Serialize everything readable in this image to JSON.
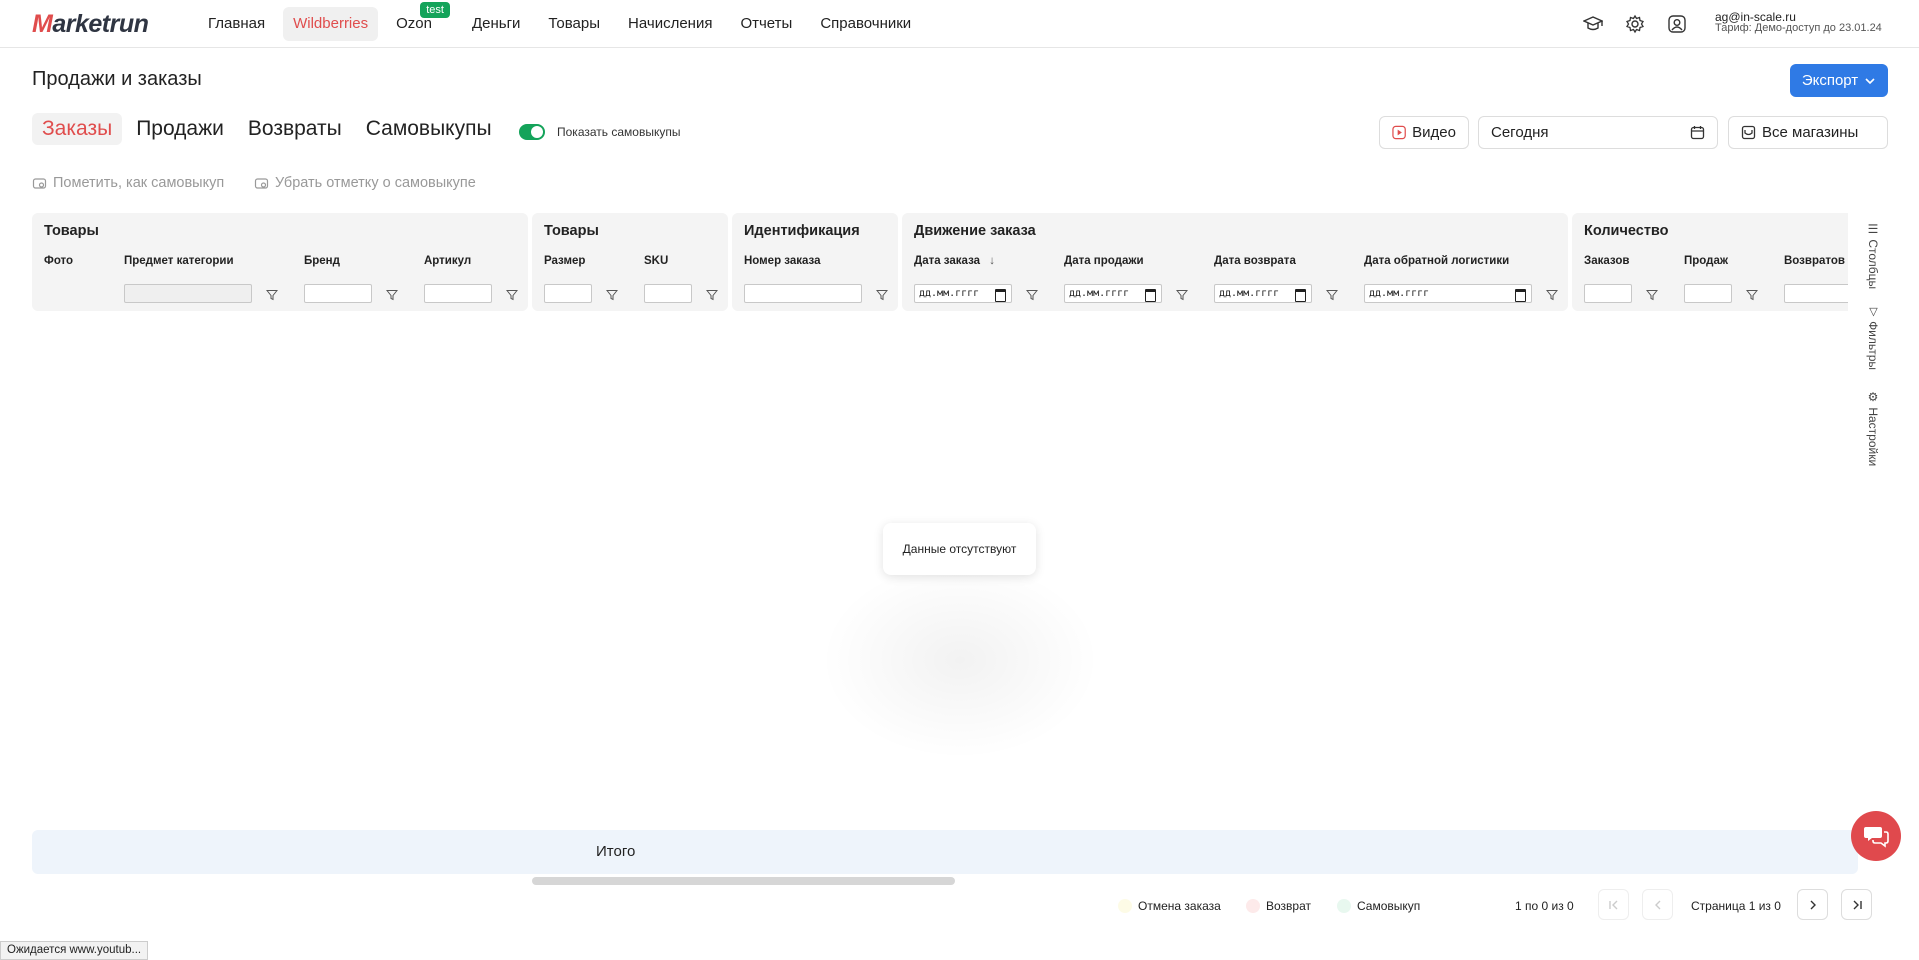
{
  "header": {
    "logo_first": "M",
    "logo_rest": "arketrun",
    "nav": [
      {
        "label": "Главная",
        "active": false
      },
      {
        "label": "Wildberries",
        "active": true
      },
      {
        "label": "Ozon",
        "active": false,
        "badge": "test"
      },
      {
        "label": "Деньги",
        "active": false
      },
      {
        "label": "Товары",
        "active": false
      },
      {
        "label": "Начисления",
        "active": false
      },
      {
        "label": "Отчеты",
        "active": false
      },
      {
        "label": "Справочники",
        "active": false
      }
    ],
    "icons": [
      "graduation-cap-icon",
      "gear-icon",
      "user-icon"
    ],
    "user_email": "ag@in-scale.ru",
    "user_plan": "Тариф: Демо-доступ до 23.01.24"
  },
  "page": {
    "title": "Продажи и заказы",
    "export_label": "Экспорт"
  },
  "tabs": [
    {
      "label": "Заказы",
      "active": true
    },
    {
      "label": "Продажи",
      "active": false
    },
    {
      "label": "Возвраты",
      "active": false
    },
    {
      "label": "Самовыкупы",
      "active": false
    }
  ],
  "toggle": {
    "label": "Показать самовыкупы",
    "on": true
  },
  "controls": {
    "video_label": "Видео",
    "period_value": "Сегодня",
    "stores_label": "Все магазины"
  },
  "actions": {
    "mark_label": "Пометить, как самовыкуп",
    "unmark_label": "Убрать отметку о самовыкупе"
  },
  "table": {
    "groups": [
      {
        "title": "Товары",
        "columns": [
          "Фото",
          "Предмет категории",
          "Бренд",
          "Артикул"
        ]
      },
      {
        "title": "Товары",
        "columns": [
          "Размер",
          "SKU"
        ]
      },
      {
        "title": "Идентификация",
        "columns": [
          "Номер заказа"
        ]
      },
      {
        "title": "Движение заказа",
        "columns": [
          "Дата заказа",
          "Дата продажи",
          "Дата возврата",
          "Дата обратной логистики"
        ]
      },
      {
        "title": "Количество",
        "columns": [
          "Заказов",
          "Продаж",
          "Возвратов"
        ]
      }
    ],
    "date_placeholder": "дд.мм.гггг",
    "sort_indicator": "↓",
    "empty_text": "Данные отсутствуют",
    "total_label": "Итого"
  },
  "side_tools": [
    "Столбцы",
    "Фильтры",
    "Настройки"
  ],
  "legend": [
    {
      "label": "Отмена заказа",
      "color": "#fdfbe6"
    },
    {
      "label": "Возврат",
      "color": "#fdeaea"
    },
    {
      "label": "Самовыкуп",
      "color": "#e8f8ef"
    }
  ],
  "pagination": {
    "range": "1 по 0 из 0",
    "page_text": "Страница 1 из 0"
  },
  "status_bar": "Ожидается www.youtub...",
  "colors": {
    "brand": "#e04d4d",
    "accent": "#2f7ae5",
    "toggle": "#14a35a",
    "chat": "#e0494d"
  }
}
